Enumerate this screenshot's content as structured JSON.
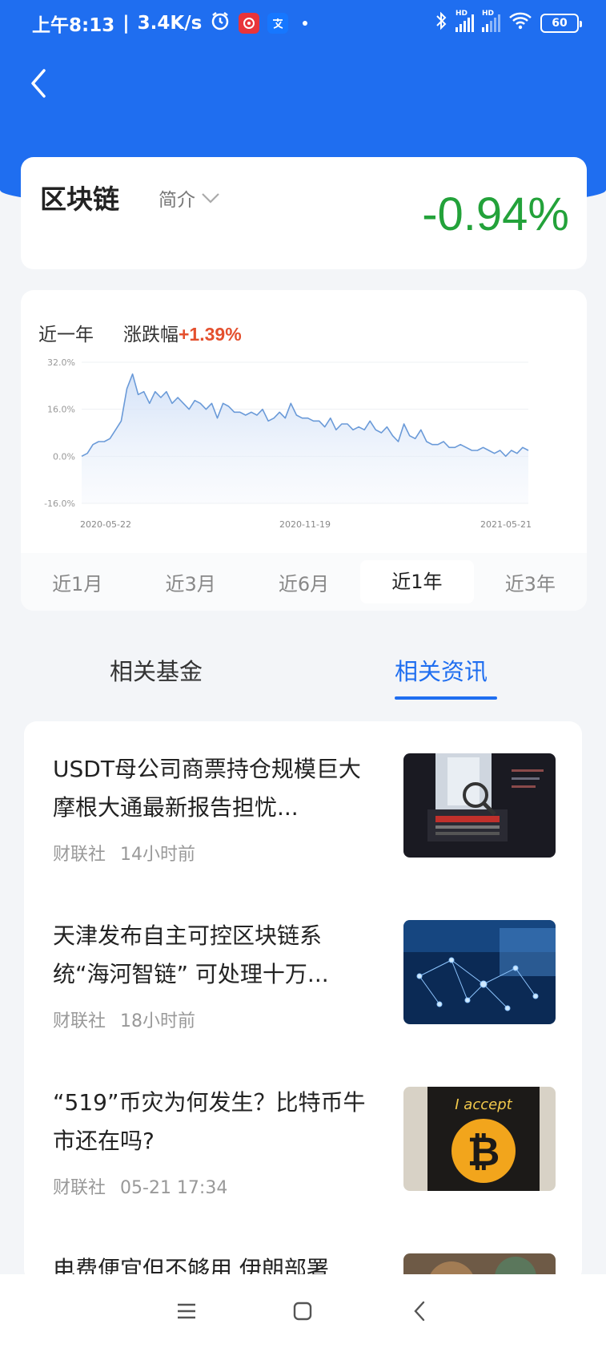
{
  "status_bar": {
    "time": "上午8:13",
    "net_speed": "3.4K/s",
    "battery": "60",
    "icons": [
      "alarm-icon",
      "netease-music-icon",
      "alipay-icon",
      "bluetooth-icon",
      "signal-hd-icon",
      "signal-hd-icon",
      "wifi-icon",
      "battery-icon"
    ]
  },
  "header": {
    "back_icon": "chevron-left-icon",
    "accent_color": "#1f6ef0"
  },
  "sector": {
    "name": "区块链",
    "intro_label": "简介",
    "change_pct": "-0.94%",
    "change_color": "#23a23a"
  },
  "chart_card": {
    "period_label": "近一年",
    "change_label": "涨跌幅",
    "change_value": "+1.39%",
    "range_tabs": [
      "近1月",
      "近3月",
      "近6月",
      "近1年",
      "近3年"
    ],
    "active_range": "近1年"
  },
  "chart_data": {
    "type": "area",
    "title": "",
    "xlabel": "",
    "ylabel": "",
    "ylim": [
      -16,
      32
    ],
    "y_ticks": [
      "32.0%",
      "16.0%",
      "0.0%",
      "-16.0%"
    ],
    "x_tick_labels": [
      "2020-05-22",
      "2020-11-19",
      "2021-05-21"
    ],
    "grid": true,
    "series": [
      {
        "values": [
          0,
          1,
          4,
          5,
          5,
          6,
          9,
          12,
          23,
          28,
          21,
          22,
          18,
          22,
          20,
          22,
          18,
          20,
          18,
          16,
          19,
          18,
          16,
          18,
          13,
          18,
          17,
          15,
          15,
          14,
          15,
          14,
          16,
          12,
          13,
          15,
          13,
          18,
          14,
          13,
          13,
          12,
          12,
          10,
          13,
          9,
          11,
          11,
          9,
          10,
          9,
          12,
          9,
          8,
          10,
          7,
          5,
          11,
          7,
          6,
          9,
          5,
          4,
          4,
          5,
          3,
          3,
          4,
          3,
          2,
          2,
          3,
          2,
          1,
          2,
          0,
          2,
          1,
          3,
          2
        ]
      }
    ]
  },
  "tabs": {
    "related_funds": "相关基金",
    "related_news": "相关资讯",
    "active": "相关资讯"
  },
  "news": [
    {
      "title": "USDT母公司商票持仓规模巨大 摩根大通最新报告担忧...",
      "source": "财联社",
      "time": "14小时前",
      "thumb": "magnifier-laptop-image"
    },
    {
      "title": "天津发布自主可控区块链系统“海河智链” 可处理十万...",
      "source": "财联社",
      "time": "18小时前",
      "thumb": "network-nodes-image"
    },
    {
      "title": "“519”币灾为何发生？比特币牛市还在吗?",
      "source": "财联社",
      "time": "05-21 17:34",
      "thumb": "bitcoin-sign-image"
    },
    {
      "title": "电费便宜但不够用 伊朗部署",
      "source": "",
      "time": "",
      "thumb": "mining-image"
    }
  ],
  "nav_bar": {
    "icons": [
      "menu-icon",
      "home-icon",
      "back-icon"
    ]
  }
}
